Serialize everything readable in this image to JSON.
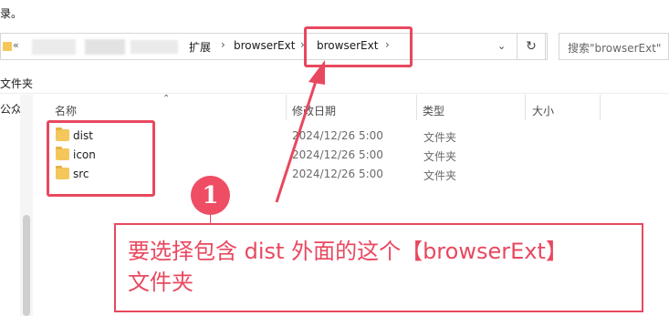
{
  "top_text": "录。",
  "address": {
    "overflow": "«",
    "crumbs": [
      "扩展",
      "browserExt",
      "browserExt"
    ],
    "sep": "›",
    "dropdown": "⌄",
    "refresh": "↻",
    "search_placeholder": "搜索\"browserExt\""
  },
  "toolbar": {
    "partial_label": "文件夹"
  },
  "nav": {
    "partial_label": "公众"
  },
  "columns": {
    "name": "名称",
    "modified": "修改日期",
    "type": "类型",
    "size": "大小"
  },
  "files": [
    {
      "name": "dist",
      "modified": "2024/12/26 5:00",
      "type": "文件夹"
    },
    {
      "name": "icon",
      "modified": "2024/12/26 5:00",
      "type": "文件夹"
    },
    {
      "name": "src",
      "modified": "2024/12/26 5:00",
      "type": "文件夹"
    }
  ],
  "annotation": {
    "step_number": "1",
    "line1": "要选择包含 dist 外面的这个【browserExt】",
    "line2": "文件夹",
    "accent_color": "#e8485f"
  },
  "icons": {
    "folder": "folder-icon",
    "refresh": "refresh-icon",
    "dropdown": "chevron-down-icon",
    "sort": "sort-ascending-icon"
  }
}
